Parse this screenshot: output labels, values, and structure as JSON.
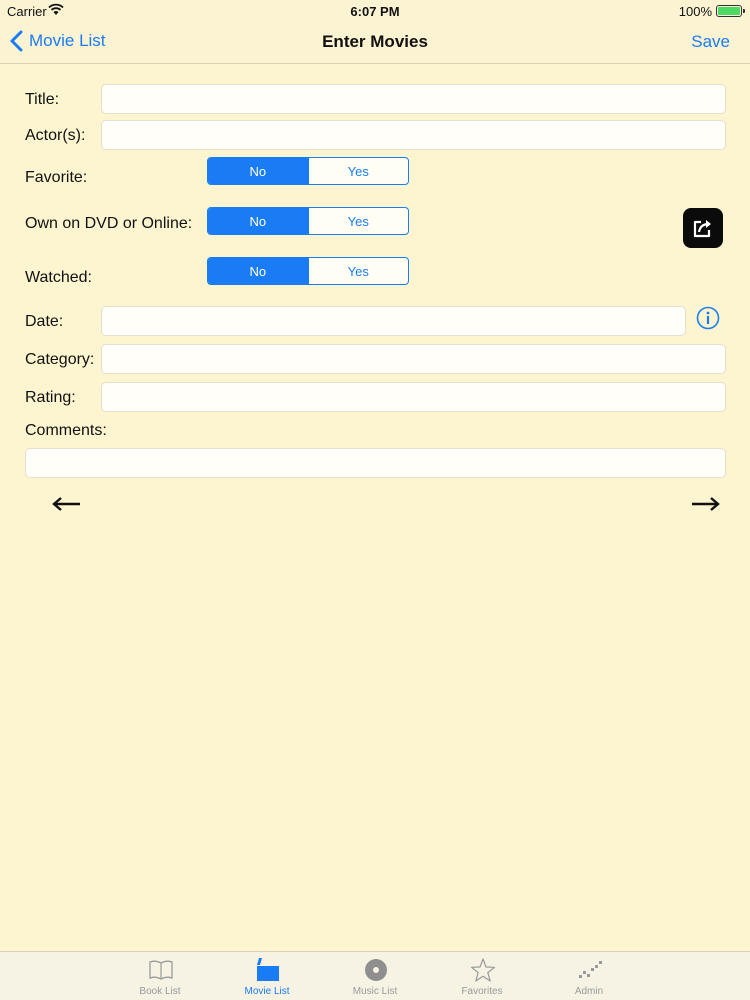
{
  "status_bar": {
    "carrier": "Carrier",
    "time": "6:07 PM",
    "battery": "100%"
  },
  "nav": {
    "back_label": "Movie List",
    "title": "Enter Movies",
    "save_label": "Save"
  },
  "form": {
    "title_label": "Title:",
    "title_value": "",
    "actors_label": "Actor(s):",
    "actors_value": "",
    "favorite_label": "Favorite:",
    "favorite": {
      "no": "No",
      "yes": "Yes",
      "selected": "No"
    },
    "own_label": "Own on DVD or Online:",
    "own": {
      "no": "No",
      "yes": "Yes",
      "selected": "No"
    },
    "watched_label": "Watched:",
    "watched": {
      "no": "No",
      "yes": "Yes",
      "selected": "No"
    },
    "date_label": "Date:",
    "date_value": "",
    "category_label": "Category:",
    "category_value": "",
    "rating_label": "Rating:",
    "rating_value": "",
    "comments_label": "Comments:",
    "comments_value": ""
  },
  "icons": {
    "share": "share-icon",
    "info": "info-icon",
    "prev": "left-arrow-icon",
    "next": "right-arrow-icon"
  },
  "tabs": [
    {
      "label": "Book List",
      "icon": "book-icon",
      "active": false
    },
    {
      "label": "Movie List",
      "icon": "clapperboard-icon",
      "active": true
    },
    {
      "label": "Music List",
      "icon": "disc-icon",
      "active": false
    },
    {
      "label": "Favorites",
      "icon": "star-icon",
      "active": false
    },
    {
      "label": "Admin",
      "icon": "admin-icon",
      "active": false
    }
  ],
  "colors": {
    "accent": "#1a7cf5",
    "background": "#fdf5cf",
    "battery": "#4cd964"
  }
}
